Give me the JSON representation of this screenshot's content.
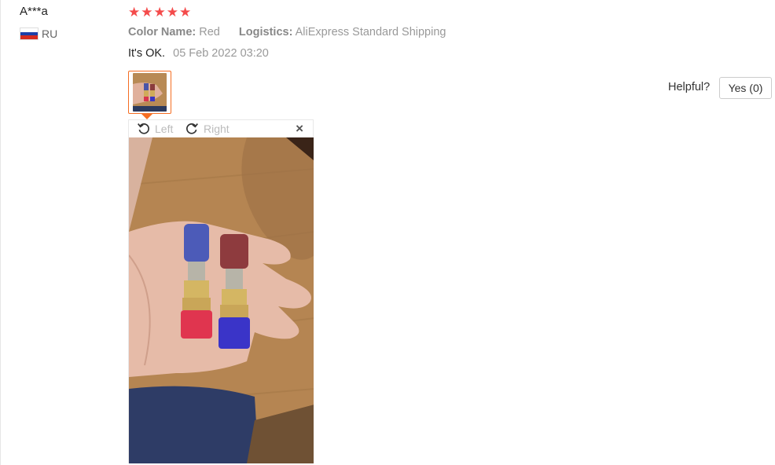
{
  "review": {
    "user_name": "A***a",
    "country_code": "RU",
    "rating": 5,
    "color_label": "Color Name:",
    "color_value": "Red",
    "logistics_label": "Logistics:",
    "logistics_value": "AliExpress Standard Shipping",
    "feedback_text": "It's OK.",
    "date": "05 Feb 2022 03:20"
  },
  "viewer": {
    "rotate_left_label": "Left",
    "rotate_right_label": "Right",
    "close_symbol": "×"
  },
  "helpful": {
    "label": "Helpful?",
    "yes_label": "Yes (0)"
  },
  "colors": {
    "star": "#f44b4b",
    "accent": "#f56e23",
    "flag_white": "#ffffff",
    "flag_blue": "#1c3fa8",
    "flag_red": "#d52b1e"
  },
  "icons": [
    "flag-russia-icon",
    "star-icon",
    "rotate-left-icon",
    "rotate-right-icon",
    "close-icon"
  ]
}
